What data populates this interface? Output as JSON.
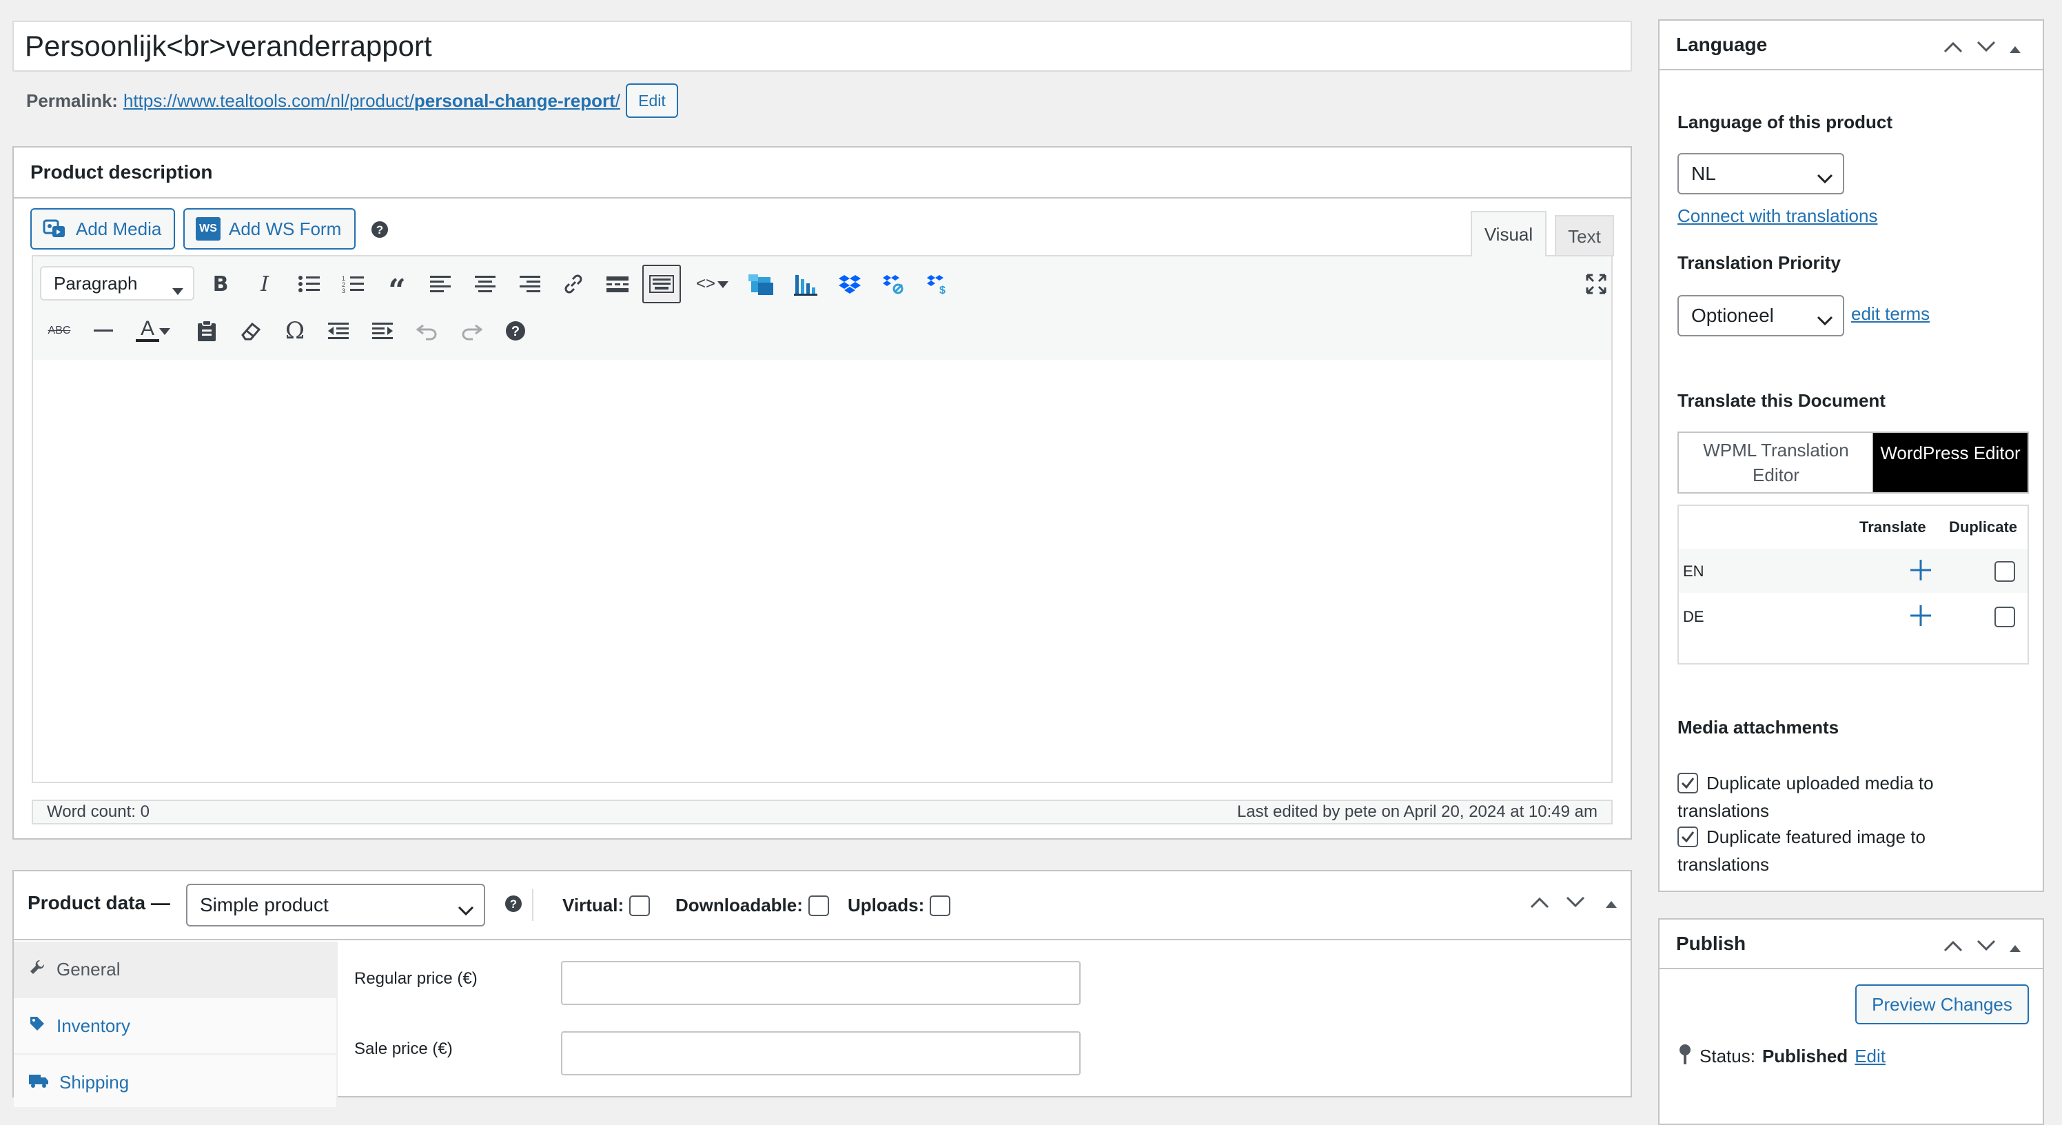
{
  "title": {
    "value": "Persoonlijk<br>veranderrapport"
  },
  "permalink": {
    "label": "Permalink:",
    "url_prefix": "https://www.tealtools.com/nl/product/",
    "slug": "personal-change-report",
    "url_suffix": "/",
    "edit_label": "Edit"
  },
  "description": {
    "heading": "Product description",
    "add_media": "Add Media",
    "add_ws_form": "Add WS Form",
    "ws_badge": "WS",
    "tab_visual": "Visual",
    "tab_text": "Text",
    "format_select": "Paragraph",
    "word_count": "Word count: 0",
    "last_edited": "Last edited by pete on April 20, 2024 at 10:49 am"
  },
  "product_data": {
    "label": "Product data —",
    "type_select": "Simple product",
    "virtual": "Virtual:",
    "downloadable": "Downloadable:",
    "uploads": "Uploads:",
    "tabs": [
      {
        "label": "General",
        "icon": "wrench-icon"
      },
      {
        "label": "Inventory",
        "icon": "tag-icon"
      },
      {
        "label": "Shipping",
        "icon": "truck-icon"
      }
    ],
    "regular_price_label": "Regular price (€)",
    "sale_price_label": "Sale price (€)"
  },
  "language_box": {
    "heading": "Language",
    "language_of_product": "Language of this product",
    "language_value": "NL",
    "connect_link": "Connect with translations",
    "priority_label": "Translation Priority",
    "priority_value": "Optioneel",
    "edit_terms": "edit terms",
    "translate_doc": "Translate this Document",
    "wpml_editor": "WPML Translation Editor",
    "wp_editor": "WordPress Editor",
    "col_translate": "Translate",
    "col_duplicate": "Duplicate",
    "languages": [
      "EN",
      "DE"
    ],
    "media_heading": "Media attachments",
    "dup_media": "Duplicate uploaded media to translations",
    "dup_featured": "Duplicate featured image to translations"
  },
  "publish_box": {
    "heading": "Publish",
    "preview": "Preview Changes",
    "status_label": "Status:",
    "status_value": "Published",
    "status_edit": "Edit"
  },
  "colors": {
    "accent": "#2271b1",
    "border": "#c3c4c7",
    "background": "#f0f0f1"
  }
}
